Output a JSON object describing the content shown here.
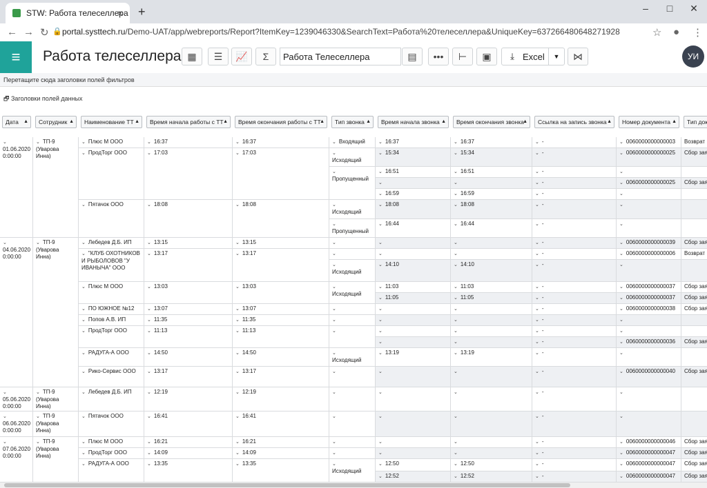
{
  "browser": {
    "tab_title": "STW: Работа телеселлера",
    "url_host": "portal.systtech.ru",
    "url_path": "/Demo-UAT/app/webreports/Report?ItemKey=1239046330&SearchText=Работа%20телеселлера&UniqueKey=637266480648271928"
  },
  "app": {
    "title": "Работа телеселлера",
    "report_name": "Работа Телеселлера",
    "export_label": "Excel",
    "user_initials": "УИ"
  },
  "filters": {
    "drop_hint": "Перетащите сюда заголовки полей фильтров",
    "data_fields": "Заголовки полей данных"
  },
  "columns": [
    "Дата",
    "Сотрудник",
    "Наименование ТТ",
    "Время начала работы с ТТ",
    "Время окончания работы с ТТ",
    "Тип звонка",
    "Время начала звонка",
    "Время окончания звонка",
    "Ссылка на запись звонка",
    "Номер документа",
    "Тип док"
  ],
  "groups": [
    {
      "date": "01.06.2020 0:00:00",
      "emp": "ТП-9 (Уварова Инна)"
    },
    {
      "date": "04.06.2020 0:00:00",
      "emp": "ТП-9 (Уварова Инна)"
    },
    {
      "date": "05.06.2020 0:00:00",
      "emp": "ТП-9 (Уварова Инна)"
    },
    {
      "date": "06.06.2020 0:00:00",
      "emp": "ТП-9 (Уварова Инна)"
    },
    {
      "date": "07.06.2020 0:00:00",
      "emp": "ТП-9 (Уварова Инна)"
    }
  ],
  "stores": [
    {
      "name": "Плюс М ООО",
      "start": "16:37",
      "end": "16:37"
    },
    {
      "name": "ПродТорг ООО",
      "start": "17:03",
      "end": "17:03"
    },
    {
      "name": "Пятачок ООО",
      "start": "18:08",
      "end": "18:08"
    },
    {
      "name": "Лебедев Д.Б. ИП",
      "start": "13:15",
      "end": "13:15"
    },
    {
      "name": "\"КЛУБ ОХОТНИКОВ И РЫБОЛОВОВ \"У ИВАНЫЧА\" ООО",
      "start": "13:17",
      "end": "13:17"
    },
    {
      "name": "Плюс М ООО",
      "start": "13:03",
      "end": "13:03"
    },
    {
      "name": "ПО ЮЖНОЕ №12",
      "start": "13:07",
      "end": "13:07"
    },
    {
      "name": "Попов А.В. ИП",
      "start": "11:35",
      "end": "11:35"
    },
    {
      "name": "ПродТорг ООО",
      "start": "11:13",
      "end": "11:13"
    },
    {
      "name": "РАДУГА-А ООО",
      "start": "14:50",
      "end": "14:50"
    },
    {
      "name": "Рико-Сервис ООО",
      "start": "13:17",
      "end": "13:17"
    },
    {
      "name": "Лебедев Д.Б. ИП",
      "start": "12:19",
      "end": "12:19"
    },
    {
      "name": "Пятачок ООО",
      "start": "16:41",
      "end": "16:41"
    },
    {
      "name": "Плюс М ООО",
      "start": "16:21",
      "end": "16:21"
    },
    {
      "name": "ПродТорг ООО",
      "start": "14:09",
      "end": "14:09"
    },
    {
      "name": "РАДУГА-А ООО",
      "start": "13:35",
      "end": "13:35"
    }
  ],
  "calltypes": [
    "Входящий",
    "Исходящий",
    "Пропущенный",
    "Исходящий",
    "Пропущенный",
    "Исходящий",
    "Исходящий",
    "Исходящий",
    "Исходящий"
  ],
  "calls": [
    {
      "s": "16:37",
      "e": "16:37",
      "doc": "0060000000000003",
      "type": "Возврат"
    },
    {
      "s": "15:34",
      "e": "15:34",
      "doc": "0060000000000025",
      "type": "Сбор зая"
    },
    {
      "s": "16:51",
      "e": "16:51",
      "doc": "",
      "type": ""
    },
    {
      "s": "",
      "e": "",
      "doc": "0060000000000025",
      "type": "Сбор зая"
    },
    {
      "s": "16:59",
      "e": "16:59",
      "doc": "",
      "type": ""
    },
    {
      "s": "18:08",
      "e": "18:08",
      "doc": "",
      "type": ""
    },
    {
      "s": "16:44",
      "e": "16:44",
      "doc": "",
      "type": ""
    },
    {
      "s": "",
      "e": "",
      "doc": "0060000000000039",
      "type": "Сбор зая"
    },
    {
      "s": "",
      "e": "",
      "doc": "0060000000000006",
      "type": "Возврат"
    },
    {
      "s": "14:10",
      "e": "14:10",
      "doc": "",
      "type": ""
    },
    {
      "s": "11:03",
      "e": "11:03",
      "doc": "0060000000000037",
      "type": "Сбор зая"
    },
    {
      "s": "11:05",
      "e": "11:05",
      "doc": "0060000000000037",
      "type": "Сбор зая"
    },
    {
      "s": "",
      "e": "",
      "doc": "0060000000000038",
      "type": "Сбор зая"
    },
    {
      "s": "",
      "e": "",
      "doc": "",
      "type": ""
    },
    {
      "s": "",
      "e": "",
      "doc": "",
      "type": ""
    },
    {
      "s": "",
      "e": "",
      "doc": "0060000000000036",
      "type": "Сбор зая"
    },
    {
      "s": "13:19",
      "e": "13:19",
      "doc": "",
      "type": ""
    },
    {
      "s": "",
      "e": "",
      "doc": "0060000000000040",
      "type": "Сбор зая"
    },
    {
      "s": "",
      "e": "",
      "doc": "",
      "type": ""
    },
    {
      "s": "",
      "e": "",
      "doc": "",
      "type": ""
    },
    {
      "s": "",
      "e": "",
      "doc": "0060000000000046",
      "type": "Сбор зая"
    },
    {
      "s": "",
      "e": "",
      "doc": "0060000000000047",
      "type": "Сбор зая"
    },
    {
      "s": "12:50",
      "e": "12:50",
      "doc": "0060000000000047",
      "type": "Сбор зая"
    },
    {
      "s": "12:52",
      "e": "12:52",
      "doc": "0060000000000047",
      "type": "Сбор зая"
    }
  ]
}
